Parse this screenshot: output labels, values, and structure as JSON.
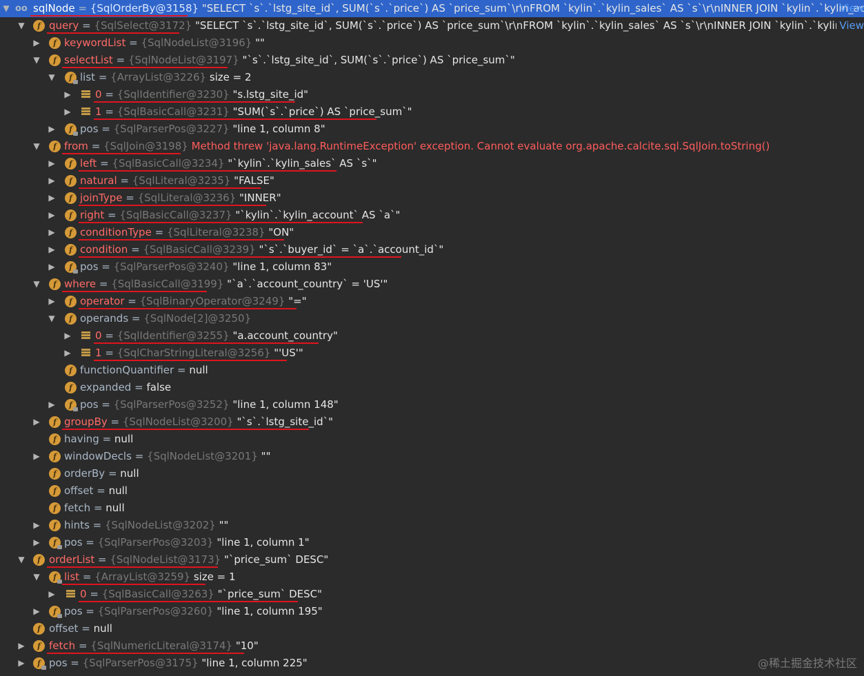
{
  "rows": [
    {
      "name": "sqlNode",
      "ref": "{SqlOrderBy@3158}",
      "value": "\"SELECT `s`.`lstg_site_id`, SUM(`s`.`price`) AS `price_sum`\\r\\nFROM `kylin`.`kylin_sales` AS `s`\\r\\nINNER JOIN `kylin`.`kylin_account` A...",
      "view": "View"
    },
    {
      "name": "query",
      "ref": "{SqlSelect@3172}",
      "value": "\"SELECT `s`.`lstg_site_id`, SUM(`s`.`price`) AS `price_sum`\\r\\nFROM `kylin`.`kylin_sales` AS `s`\\r\\nINNER JOIN `kylin`.`kylin_account` AS ...",
      "view": "View"
    },
    {
      "name": "keywordList",
      "ref": "{SqlNodeList@3196}",
      "value": "\"\""
    },
    {
      "name": "selectList",
      "ref": "{SqlNodeList@3197}",
      "value": "\"`s`.`lstg_site_id`, SUM(`s`.`price`) AS `price_sum`\""
    },
    {
      "name": "list",
      "ref": "{ArrayList@3226}",
      "value": "size = 2"
    },
    {
      "name": "0",
      "ref": "{SqlIdentifier@3230}",
      "value": "\"s.lstg_site_id\""
    },
    {
      "name": "1",
      "ref": "{SqlBasicCall@3231}",
      "value": "\"SUM(`s`.`price`) AS `price_sum`\""
    },
    {
      "name": "pos",
      "ref": "{SqlParserPos@3227}",
      "value": "\"line 1, column 8\""
    },
    {
      "name": "from",
      "ref": "{SqlJoin@3198}",
      "value": "Method threw 'java.lang.RuntimeException' exception. Cannot evaluate org.apache.calcite.sql.SqlJoin.toString()"
    },
    {
      "name": "left",
      "ref": "{SqlBasicCall@3234}",
      "value": "\"`kylin`.`kylin_sales` AS `s`\""
    },
    {
      "name": "natural",
      "ref": "{SqlLiteral@3235}",
      "value": "\"FALSE\""
    },
    {
      "name": "joinType",
      "ref": "{SqlLiteral@3236}",
      "value": "\"INNER\""
    },
    {
      "name": "right",
      "ref": "{SqlBasicCall@3237}",
      "value": "\"`kylin`.`kylin_account` AS `a`\""
    },
    {
      "name": "conditionType",
      "ref": "{SqlLiteral@3238}",
      "value": "\"ON\""
    },
    {
      "name": "condition",
      "ref": "{SqlBasicCall@3239}",
      "value": "\"`s`.`buyer_id` = `a`.`account_id`\""
    },
    {
      "name": "pos",
      "ref": "{SqlParserPos@3240}",
      "value": "\"line 1, column 83\""
    },
    {
      "name": "where",
      "ref": "{SqlBasicCall@3199}",
      "value": "\"`a`.`account_country` = 'US'\""
    },
    {
      "name": "operator",
      "ref": "{SqlBinaryOperator@3249}",
      "value": "\"=\""
    },
    {
      "name": "operands",
      "ref": "{SqlNode[2]@3250}",
      "value": ""
    },
    {
      "name": "0",
      "ref": "{SqlIdentifier@3255}",
      "value": "\"a.account_country\""
    },
    {
      "name": "1",
      "ref": "{SqlCharStringLiteral@3256}",
      "value": "\"'US'\""
    },
    {
      "name": "functionQuantifier",
      "ref": "",
      "value": "null"
    },
    {
      "name": "expanded",
      "ref": "",
      "value": "false"
    },
    {
      "name": "pos",
      "ref": "{SqlParserPos@3252}",
      "value": "\"line 1, column 148\""
    },
    {
      "name": "groupBy",
      "ref": "{SqlNodeList@3200}",
      "value": "\"`s`.`lstg_site_id`\""
    },
    {
      "name": "having",
      "ref": "",
      "value": "null"
    },
    {
      "name": "windowDecls",
      "ref": "{SqlNodeList@3201}",
      "value": "\"\""
    },
    {
      "name": "orderBy",
      "ref": "",
      "value": "null"
    },
    {
      "name": "offset",
      "ref": "",
      "value": "null"
    },
    {
      "name": "fetch",
      "ref": "",
      "value": "null"
    },
    {
      "name": "hints",
      "ref": "{SqlNodeList@3202}",
      "value": "\"\""
    },
    {
      "name": "pos",
      "ref": "{SqlParserPos@3203}",
      "value": "\"line 1, column 1\""
    },
    {
      "name": "orderList",
      "ref": "{SqlNodeList@3173}",
      "value": "\"`price_sum` DESC\""
    },
    {
      "name": "list",
      "ref": "{ArrayList@3259}",
      "value": "size = 1"
    },
    {
      "name": "0",
      "ref": "{SqlBasicCall@3263}",
      "value": "\"`price_sum` DESC\""
    },
    {
      "name": "pos",
      "ref": "{SqlParserPos@3260}",
      "value": "\"line 1, column 195\""
    },
    {
      "name": "offset",
      "ref": "",
      "value": "null"
    },
    {
      "name": "fetch",
      "ref": "{SqlNumericLiteral@3174}",
      "value": "\"10\""
    },
    {
      "name": "pos",
      "ref": "{SqlParserPos@3175}",
      "value": "\"line 1, column 225\""
    }
  ],
  "watermark": "@稀土掘金技术社区",
  "colors": {
    "background": "#2b2b2b",
    "selection": "#2f65ca",
    "field_icon": "#d69a38",
    "highlight_name": "#ff6b68",
    "error_text": "#ff5c5c",
    "underline": "#e0141e"
  }
}
